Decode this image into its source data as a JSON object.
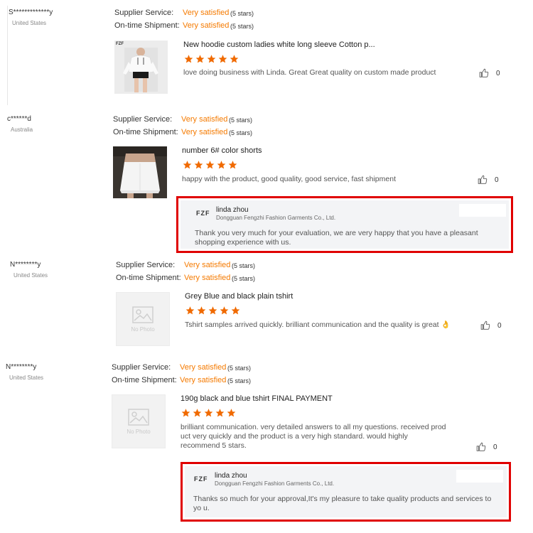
{
  "reviews": [
    {
      "user": "S*************y",
      "country": "United States",
      "supplier_label": "Supplier Service:",
      "supplier_value": "Very satisfied",
      "supplier_stars": "(5 stars)",
      "shipment_label": "On-time Shipment:",
      "shipment_value": "Very satisfied",
      "shipment_stars": "(5 stars)",
      "product_title": "New hoodie custom ladies white long sleeve Cotton p...",
      "rating": 5,
      "comment": "love doing business with Linda. Great Great quality on custom made product",
      "likes": "0",
      "image_logo": "FZF"
    },
    {
      "user": "c******d",
      "country": "Australia",
      "supplier_label": "Supplier Service:",
      "supplier_value": "Very satisfied",
      "supplier_stars": "(5 stars)",
      "shipment_label": "On-time Shipment:",
      "shipment_value": "Very satisfied",
      "shipment_stars": "(5 stars)",
      "product_title": "number 6# color shorts",
      "rating": 5,
      "comment": "happy with the product, good quality, good service, fast shipment",
      "likes": "0",
      "reply": {
        "logo": "FZF",
        "name": "linda zhou",
        "company": "Dongguan Fengzhi Fashion Garments Co., Ltd.",
        "text": "Thank you very much for your evaluation, we are very happy that you have a pleasant shopping experience with us."
      }
    },
    {
      "user": "N********y",
      "country": "United States",
      "supplier_label": "Supplier Service:",
      "supplier_value": "Very satisfied",
      "supplier_stars": "(5 stars)",
      "shipment_label": "On-time Shipment:",
      "shipment_value": "Very satisfied",
      "shipment_stars": "(5 stars)",
      "product_title": "Grey Blue and black plain tshirt",
      "rating": 5,
      "comment": "Tshirt samples arrived quickly. brilliant communication and the quality is great 👌",
      "likes": "0",
      "no_photo": "No Photo"
    },
    {
      "user": "N********y",
      "country": "United States",
      "supplier_label": "Supplier Service:",
      "supplier_value": "Very satisfied",
      "supplier_stars": "(5 stars)",
      "shipment_label": "On-time Shipment:",
      "shipment_value": "Very satisfied",
      "shipment_stars": "(5 stars)",
      "product_title": "190g black and blue tshirt FINAL PAYMENT",
      "rating": 5,
      "comment": "brilliant communication. very detailed answers to all my questions. received prod uct very quickly and the product is a very high standard. would highly recommend 5 stars.",
      "likes": "0",
      "no_photo": "No Photo",
      "reply": {
        "logo": "FZF",
        "name": "linda zhou",
        "company": "Dongguan Fengzhi Fashion Garments Co., Ltd.",
        "text": "Thanks so much for your approval,It's my pleasure to take quality products and services to yo u."
      }
    }
  ],
  "colors": {
    "accent": "#f57a00",
    "highlight": "#e00000",
    "star": "#f06a00"
  },
  "icons": {
    "star": "star-icon",
    "like": "thumbs-up-icon",
    "no_photo": "image-placeholder-icon"
  }
}
